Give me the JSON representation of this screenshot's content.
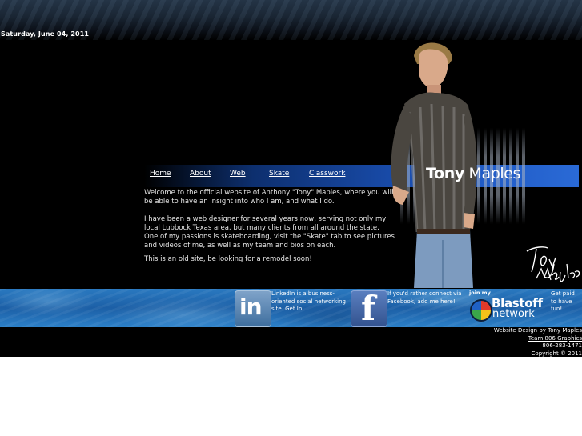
{
  "header": {
    "date": "Saturday, June 04, 2011"
  },
  "nav": {
    "items": [
      "Home",
      "About",
      "Web",
      "Skate",
      "Classwork"
    ]
  },
  "brand": {
    "first": "Tony",
    "last": "Maples",
    "signature": "Tony Maples"
  },
  "content": {
    "paragraphs": [
      "Welcome to the official website of Anthony \"Tony\" Maples, where you will be able to have an insight into who I am, and what I do.",
      "I have been a web designer for several years now, serving not only my local Lubbock Texas area, but many clients from all around the state.",
      "One of my passions is skateboarding, visit the \"Skate\" tab to see pictures and videos of me, as well as my team and bios on each.",
      "This is an old site, be looking for a remodel soon!"
    ]
  },
  "social": {
    "linkedin": {
      "icon": "linkedin-icon",
      "glyph": "in",
      "text": "LinkedIn  is a business-oriented social networking site.  Get In"
    },
    "facebook": {
      "icon": "facebook-icon",
      "glyph": "f",
      "text": "If you'd rather connect via Facebook, add me here!"
    },
    "blastoff": {
      "join": "join my",
      "name": "Blastoff",
      "sub": "network",
      "cta": "Get paid to have fun!"
    }
  },
  "footer": {
    "design": "Website Design by Tony Maples",
    "team": "Team 806 Graphics",
    "phone": "806-283-1471",
    "copyright": "Copyright © 2011"
  },
  "colors": {
    "background": "#000000",
    "nav_band": "#1d56c0",
    "water": "#1c5fa6",
    "text": "#e6e6e6"
  }
}
